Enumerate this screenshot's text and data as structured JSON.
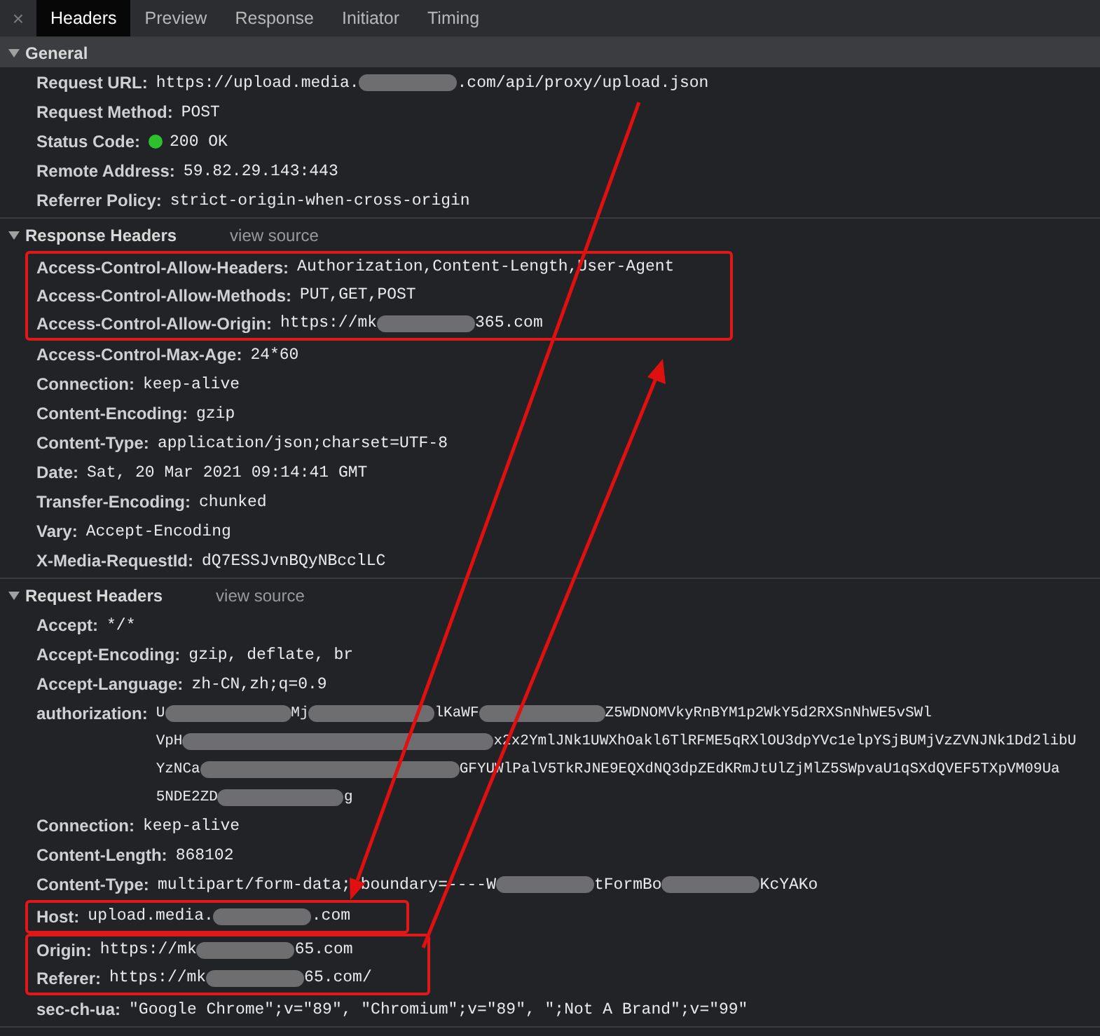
{
  "close_glyph": "×",
  "tabs": [
    {
      "label": "Headers",
      "selected": true
    },
    {
      "label": "Preview",
      "selected": false
    },
    {
      "label": "Response",
      "selected": false
    },
    {
      "label": "Initiator",
      "selected": false
    },
    {
      "label": "Timing",
      "selected": false
    }
  ],
  "sections": [
    {
      "title": "General",
      "kind": "general",
      "expanded": true,
      "rows": [
        {
          "key": "Request URL:",
          "parts": [
            {
              "kind": "text",
              "text": "https://upload.media."
            },
            {
              "kind": "redacted"
            },
            {
              "kind": "text",
              "text": ".com/api/proxy/upload.json"
            }
          ],
          "highlight": false
        },
        {
          "key": "Request Method:",
          "value": "POST",
          "highlight": false
        },
        {
          "key": "Status Code:",
          "value": "200 OK",
          "color": "#2ec12e",
          "highlight": false
        },
        {
          "key": "Remote Address:",
          "value": "59.82.29.143:443",
          "highlight": false
        },
        {
          "key": "Referrer Policy:",
          "value": "strict-origin-when-cross-origin",
          "highlight": false
        }
      ]
    },
    {
      "title": "Response Headers",
      "kind": "headers",
      "link": "view source",
      "expanded": true,
      "rows": [
        {
          "key": "Access-Control-Allow-Headers:",
          "value": "Authorization,Content-Length,User-Agent",
          "highlight": true
        },
        {
          "key": "Access-Control-Allow-Methods:",
          "value": "PUT,GET,POST",
          "highlight": true
        },
        {
          "key": "Access-Control-Allow-Origin:",
          "parts": [
            {
              "kind": "text",
              "text": "https://mk"
            },
            {
              "kind": "redacted"
            },
            {
              "kind": "text",
              "text": "365.com"
            }
          ],
          "highlight": true
        },
        {
          "key": "Access-Control-Max-Age:",
          "value": "24*60",
          "highlight": false
        },
        {
          "key": "Connection:",
          "value": "keep-alive",
          "highlight": false
        },
        {
          "key": "Content-Encoding:",
          "value": "gzip",
          "highlight": false
        },
        {
          "key": "Content-Type:",
          "value": "application/json;charset=UTF-8",
          "highlight": false
        },
        {
          "key": "Date:",
          "value": "Sat, 20 Mar 2021 09:14:41 GMT",
          "highlight": false
        },
        {
          "key": "Transfer-Encoding:",
          "value": "chunked",
          "highlight": false
        },
        {
          "key": "Vary:",
          "value": "Accept-Encoding",
          "highlight": false
        },
        {
          "key": "X-Media-RequestId:",
          "value": "dQ7ESSJvnBQyNBcclLC",
          "highlight": false
        }
      ]
    },
    {
      "title": "Request Headers",
      "kind": "headers",
      "link": "view source",
      "expanded": true,
      "rows": [
        {
          "key": "Accept:",
          "value": "*/*",
          "highlight": false
        },
        {
          "key": "Accept-Encoding:",
          "value": "gzip, deflate, br",
          "highlight": false
        },
        {
          "key": "Accept-Language:",
          "value": "zh-CN,zh;q=0.9",
          "highlight": false
        },
        {
          "key": "authorization:",
          "lines": [
            [
              {
                "kind": "text",
                "text": "U"
              },
              {
                "kind": "redacted"
              },
              {
                "kind": "text",
                "text": "Mj"
              },
              {
                "kind": "redacted"
              },
              {
                "kind": "text",
                "text": "lKaWF"
              },
              {
                "kind": "redacted"
              },
              {
                "kind": "text",
                "text": "Z5WDNOMVkyRnBYM1p2WkY5d2RXSnNhWE5vSWl"
              }
            ],
            [
              {
                "kind": "text",
                "text": "VpH"
              },
              {
                "kind": "redacted"
              },
              {
                "kind": "text",
                "text": "x2x2YmlJNk1UWXhOakl6TlRFME5qRXlOU3dpYVc1elpYSjBUMjVzZVNJNk1Dd2libU"
              }
            ],
            [
              {
                "kind": "text",
                "text": "YzNCa"
              },
              {
                "kind": "redacted"
              },
              {
                "kind": "text",
                "text": "GFYUWlPalV5TkRJNE9EQXdNQ3dpZEdKRmJtUlZjMlZ5SWpvaU1qSXdQVEF5TXpVM09Ua"
              }
            ],
            [
              {
                "kind": "text",
                "text": "5NDE2ZD"
              },
              {
                "kind": "redacted"
              },
              {
                "kind": "text",
                "text": "g"
              }
            ]
          ],
          "highlight": false
        },
        {
          "key": "Connection:",
          "value": "keep-alive",
          "highlight": false
        },
        {
          "key": "Content-Length:",
          "value": "868102",
          "highlight": false
        },
        {
          "key": "Content-Type:",
          "parts": [
            {
              "kind": "text",
              "text": "multipart/form-data; boundary=----W"
            },
            {
              "kind": "redacted"
            },
            {
              "kind": "text",
              "text": "tFormBo"
            },
            {
              "kind": "redacted"
            },
            {
              "kind": "text",
              "text": "KcYAKo"
            }
          ],
          "highlight": false
        },
        {
          "key": "Host:",
          "parts": [
            {
              "kind": "text",
              "text": "upload.media."
            },
            {
              "kind": "redacted"
            },
            {
              "kind": "text",
              "text": ".com"
            }
          ],
          "highlight": true,
          "box_start": true
        },
        {
          "key": "Origin:",
          "parts": [
            {
              "kind": "text",
              "text": "https://mk"
            },
            {
              "kind": "redacted"
            },
            {
              "kind": "text",
              "text": "65.com"
            }
          ],
          "highlight": true,
          "box_start": true
        },
        {
          "key": "Referer:",
          "parts": [
            {
              "kind": "text",
              "text": "https://mk"
            },
            {
              "kind": "redacted"
            },
            {
              "kind": "text",
              "text": "65.com/"
            }
          ],
          "highlight": true,
          "box_start": false
        },
        {
          "key": "sec-ch-ua:",
          "value": "\"Google Chrome\";v=\"89\", \"Chromium\";v=\"89\", \";Not A Brand\";v=\"99\"",
          "highlight": false
        }
      ]
    }
  ]
}
